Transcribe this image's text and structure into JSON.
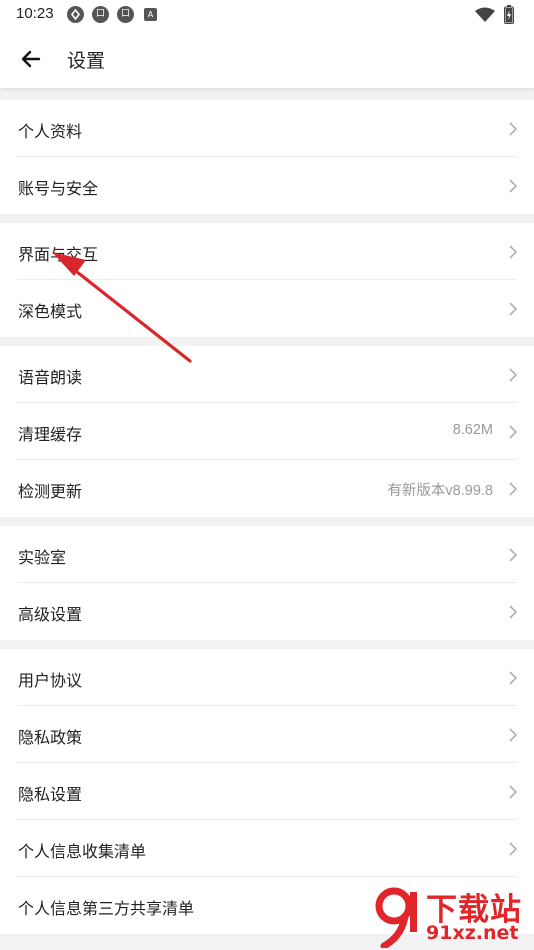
{
  "status_bar": {
    "time": "10:23",
    "icons": [
      "tracking-icon",
      "notification-icon",
      "notification-icon",
      "a-icon"
    ],
    "icon_labels": [
      "",
      "口",
      "口",
      "A"
    ],
    "right_icons": [
      "wifi-icon",
      "battery-icon"
    ]
  },
  "header": {
    "back_icon": "arrow-left-icon",
    "title": "设置"
  },
  "groups": [
    [
      {
        "label": "个人资料",
        "value": ""
      },
      {
        "label": "账号与安全",
        "value": ""
      }
    ],
    [
      {
        "label": "界面与交互",
        "value": ""
      },
      {
        "label": "深色模式",
        "value": ""
      }
    ],
    [
      {
        "label": "语音朗读",
        "value": ""
      },
      {
        "label": "清理缓存",
        "value": "8.62M"
      },
      {
        "label": "检测更新",
        "value": "有新版本v8.99.8"
      }
    ],
    [
      {
        "label": "实验室",
        "value": ""
      },
      {
        "label": "高级设置",
        "value": ""
      }
    ],
    [
      {
        "label": "用户协议",
        "value": ""
      },
      {
        "label": "隐私政策",
        "value": ""
      },
      {
        "label": "隐私设置",
        "value": ""
      },
      {
        "label": "个人信息收集清单",
        "value": ""
      },
      {
        "label": "个人信息第三方共享清单",
        "value": ""
      }
    ]
  ],
  "chevron_icon": "chevron-right-icon",
  "annotation": {
    "color": "#d9262b"
  },
  "watermark": {
    "brand": "下载站",
    "url": "91xz.net",
    "color": "#e0262a"
  },
  "colors": {
    "background": "#f2f2f2",
    "card": "#ffffff",
    "secondary_text": "#9a9a9a",
    "chevron": "#b0b0b0"
  }
}
